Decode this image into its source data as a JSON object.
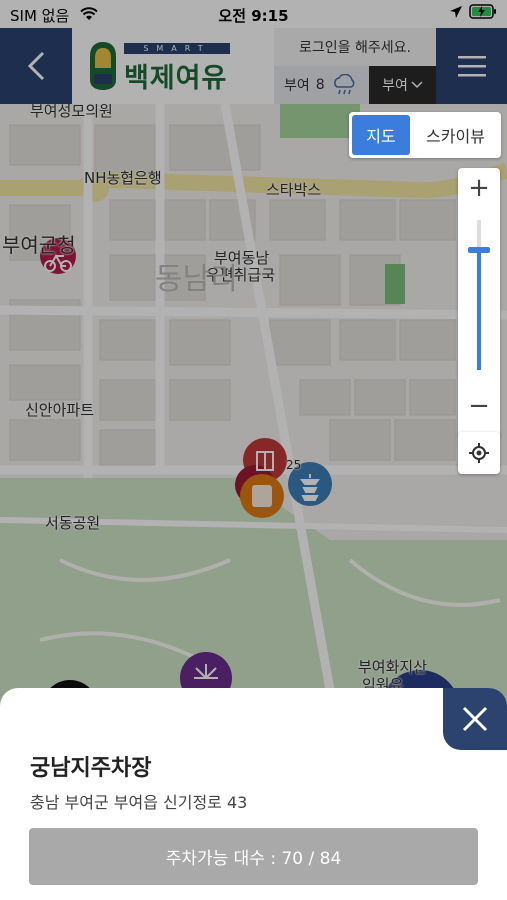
{
  "status_bar": {
    "carrier": "SIM 없음",
    "time": "오전 9:15"
  },
  "header": {
    "logo_tagline": "SMART",
    "logo_title": "백제여유",
    "login_prompt": "로그인을 해주세요.",
    "weather_location": "부여",
    "weather_temp": "8",
    "region_selector": "부여"
  },
  "map_controls": {
    "map_tab": "지도",
    "sky_tab": "스카이뷰",
    "zoom_in": "+",
    "zoom_out": "−",
    "zoom_level": 0.8
  },
  "map_labels": {
    "l1": "부여성모의원",
    "l2": "NH농협은행",
    "l3": "스타박스",
    "l4": "부여군청",
    "l5": "부여동남",
    "l6": "우편취급국",
    "l7": "신안아파트",
    "l8": "서동공원",
    "l9": "부여화지산",
    "l10": "임원유",
    "l11": "동남리",
    "l12": "25"
  },
  "parking_info": {
    "name": "궁남지주차장",
    "address": "충남 부여군 부여읍 신기정로 43",
    "availability": "주차가능 대수 : 70 / 84"
  },
  "colors": {
    "header_bg": "#2c4370",
    "map_tab_active": "#3b7ddd",
    "availability_button": "#a9a9a9"
  }
}
